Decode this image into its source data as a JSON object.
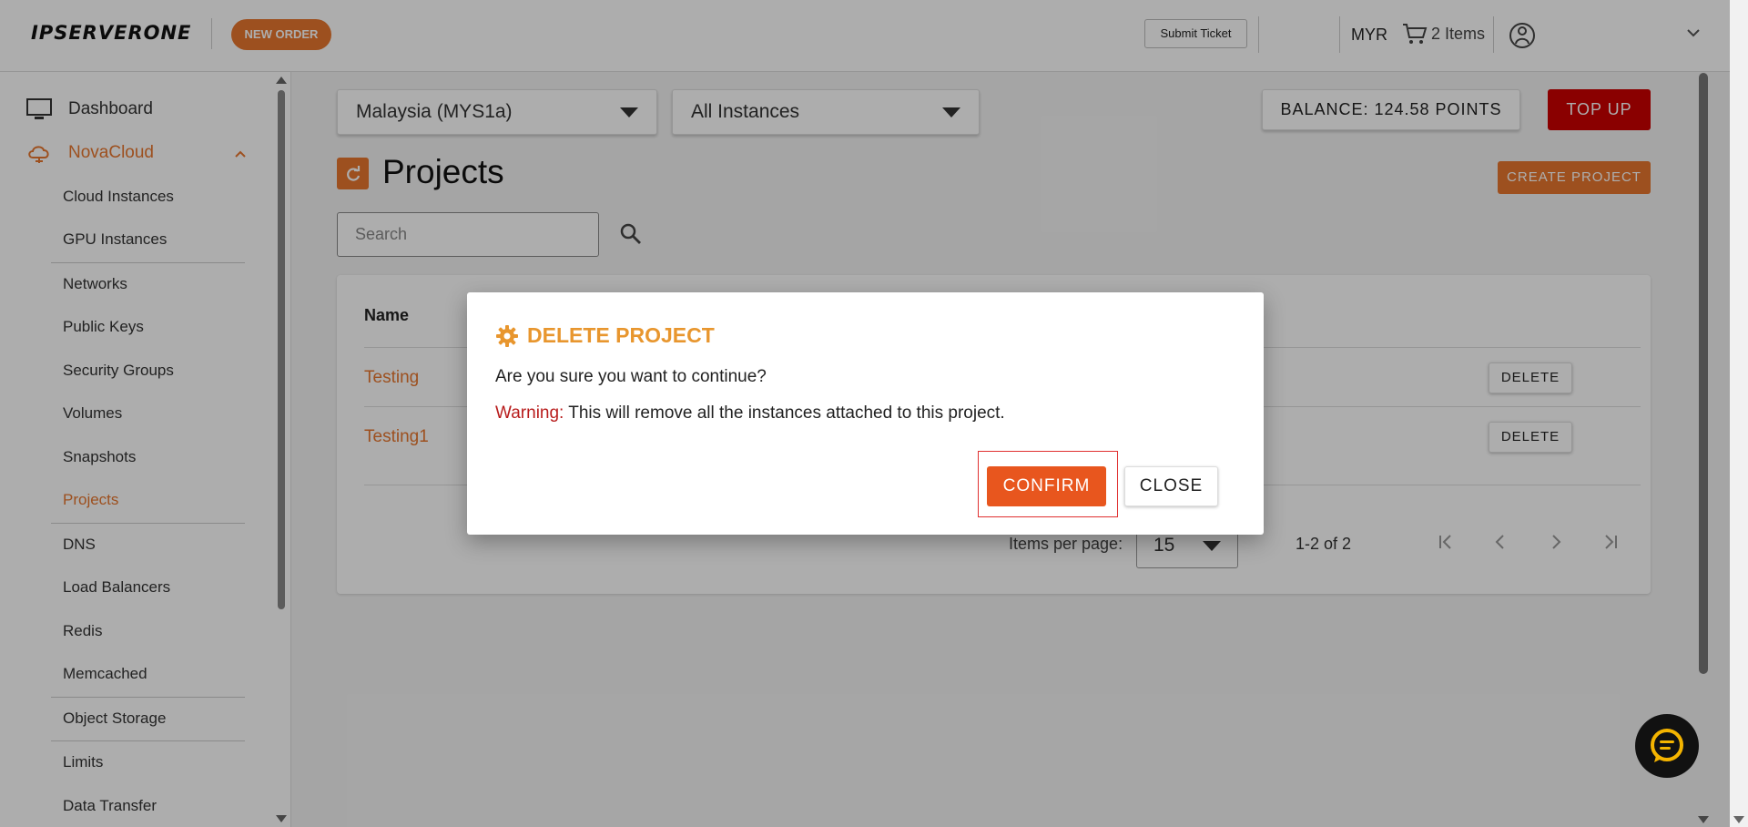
{
  "header": {
    "logo_text": "IPSERVERONE",
    "new_order_label": "NEW ORDER",
    "submit_ticket_label": "Submit Ticket",
    "currency": "MYR",
    "cart_label": "2 Items",
    "icons": [
      "cart-icon",
      "user-icon",
      "chevron-down-icon"
    ]
  },
  "sidebar": {
    "dashboard_label": "Dashboard",
    "novacloud_label": "NovaCloud",
    "items": [
      {
        "label": "Cloud Instances"
      },
      {
        "label": "GPU Instances"
      },
      {
        "label": "Networks"
      },
      {
        "label": "Public Keys"
      },
      {
        "label": "Security Groups"
      },
      {
        "label": "Volumes"
      },
      {
        "label": "Snapshots"
      },
      {
        "label": "Projects"
      },
      {
        "label": "DNS"
      },
      {
        "label": "Load Balancers"
      },
      {
        "label": "Redis"
      },
      {
        "label": "Memcached"
      },
      {
        "label": "Object Storage"
      },
      {
        "label": "Limits"
      },
      {
        "label": "Data Transfer"
      }
    ],
    "active_item": "Projects"
  },
  "toolbar": {
    "region_value": "Malaysia (MYS1a)",
    "instances_value": "All Instances",
    "balance_label": "BALANCE: 124.58 POINTS",
    "topup_label": "TOP UP"
  },
  "main": {
    "page_title": "Projects",
    "create_project_label": "CREATE PROJECT",
    "search_placeholder": "Search",
    "table": {
      "column_name": "Name",
      "rows": [
        {
          "name": "Testing",
          "action": "DELETE"
        },
        {
          "name": "Testing1",
          "action": "DELETE"
        }
      ]
    },
    "pagination": {
      "items_per_page_label": "Items per page:",
      "items_per_page_value": "15",
      "range_label": "1-2 of 2"
    }
  },
  "modal": {
    "title": "DELETE PROJECT",
    "message": "Are you sure you want to continue?",
    "warning_label": "Warning:",
    "warning_text": " This will remove all the instances attached to this project.",
    "confirm_label": "CONFIRM",
    "close_label": "CLOSE"
  },
  "colors": {
    "accent": "#e8772e",
    "danger": "#cc0000",
    "warning_text": "#b81c1c",
    "modal_title": "#e8962e"
  }
}
